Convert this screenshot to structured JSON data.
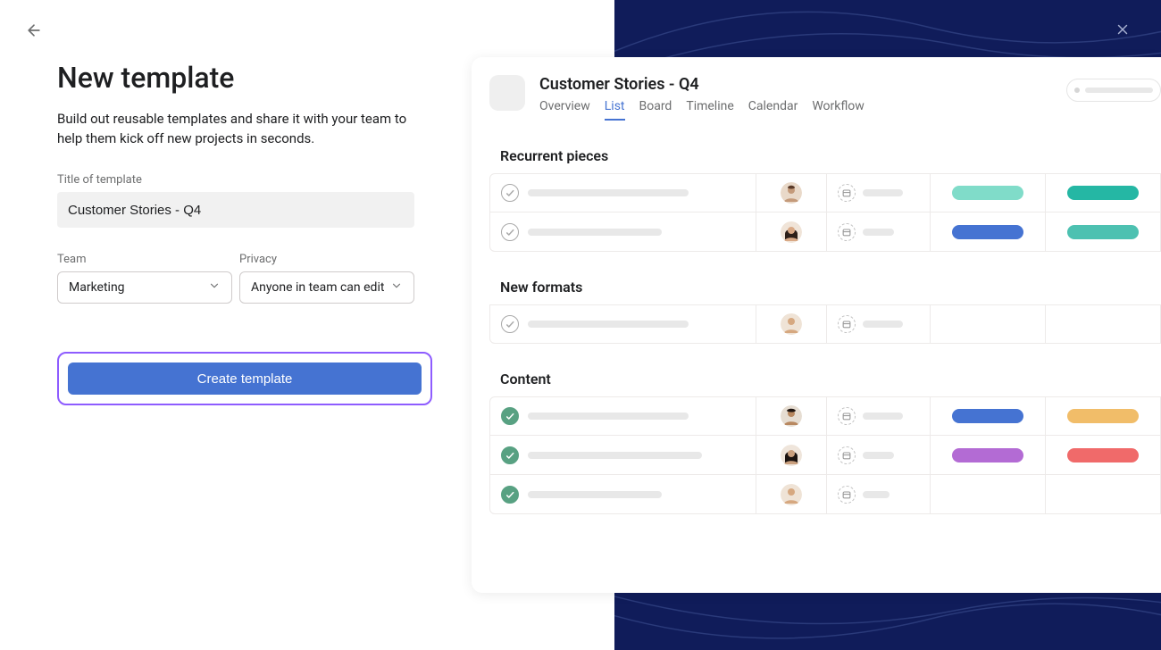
{
  "page": {
    "title": "New template",
    "description": "Build out reusable templates and share it with your team to help them kick off new projects in seconds."
  },
  "form": {
    "title_label": "Title of template",
    "title_value": "Customer Stories - Q4",
    "team_label": "Team",
    "team_value": "Marketing",
    "privacy_label": "Privacy",
    "privacy_value": "Anyone in team can edit",
    "submit_label": "Create template"
  },
  "preview": {
    "project_title": "Customer Stories - Q4",
    "tabs": [
      "Overview",
      "List",
      "Board",
      "Timeline",
      "Calendar",
      "Workflow"
    ],
    "active_tab": "List",
    "sections": [
      {
        "title": "Recurrent pieces",
        "rows": [
          {
            "done": false,
            "name_w": 180,
            "avatar": "m1",
            "date_w": 45,
            "tag1": "#80dcc9",
            "tag2": "#25b7a4"
          },
          {
            "done": false,
            "name_w": 150,
            "avatar": "f1",
            "date_w": 35,
            "tag1": "#4573d2",
            "tag2": "#4dc1b1"
          }
        ]
      },
      {
        "title": "New formats",
        "rows": [
          {
            "done": false,
            "name_w": 180,
            "avatar": "m2",
            "date_w": 45,
            "tag1": "",
            "tag2": ""
          }
        ]
      },
      {
        "title": "Content",
        "rows": [
          {
            "done": true,
            "name_w": 180,
            "avatar": "m3",
            "date_w": 45,
            "tag1": "#4573d2",
            "tag2": "#f1bd69"
          },
          {
            "done": true,
            "name_w": 195,
            "avatar": "f2",
            "date_w": 35,
            "tag1": "#b36bd4",
            "tag2": "#f06a6a"
          },
          {
            "done": true,
            "name_w": 150,
            "avatar": "m2",
            "date_w": 30,
            "tag1": "",
            "tag2": ""
          }
        ]
      }
    ]
  },
  "colors": {
    "brand_navy": "#101c5a",
    "accent_purple": "#8e5cff",
    "primary_blue": "#4573d2"
  }
}
